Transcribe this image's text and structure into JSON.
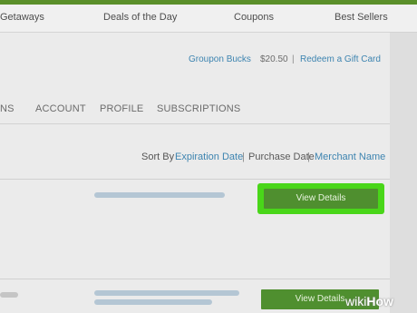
{
  "nav": {
    "items": [
      "Getaways",
      "Deals of the Day",
      "Coupons",
      "Best Sellers"
    ]
  },
  "account_bar": {
    "bucks_label": "Groupon Bucks",
    "bucks_value": "$20.50",
    "divider": "|",
    "gift_card_link": "Redeem a Gift Card"
  },
  "tabs": [
    "NS",
    "ACCOUNT",
    "PROFILE",
    "SUBSCRIPTIONS"
  ],
  "sort": {
    "label": "Sort By",
    "options": [
      "Expiration Date",
      "Purchase Date",
      "Merchant Name"
    ],
    "divider": "|"
  },
  "orders": [
    {
      "button": "View Details"
    },
    {
      "button": "View Details"
    }
  ],
  "watermark": {
    "wiki": "wiki",
    "how": "How"
  },
  "colors": {
    "accent_green": "#4f8f2f",
    "highlight_green": "#49d619",
    "link_blue": "#3d84b0"
  }
}
